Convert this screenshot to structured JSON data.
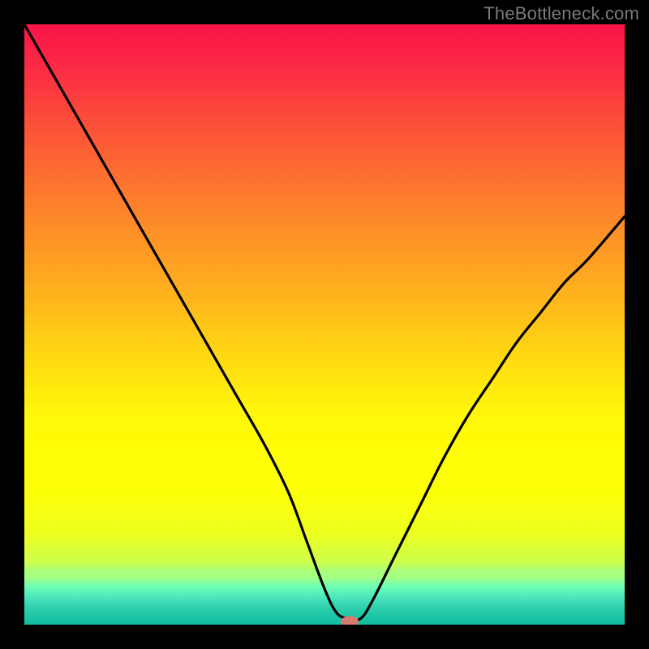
{
  "watermark": "TheBottleneck.com",
  "chart_data": {
    "type": "line",
    "title": "",
    "xlabel": "",
    "ylabel": "",
    "xlim": [
      0,
      100
    ],
    "ylim": [
      0,
      100
    ],
    "grid": false,
    "legend": false,
    "background": "rainbow_gradient_red_to_green",
    "series": [
      {
        "name": "bottleneck-curve",
        "x": [
          0,
          4,
          8,
          12,
          16,
          20,
          24,
          28,
          32,
          36,
          40,
          44,
          47,
          50,
          52,
          54,
          56,
          58,
          62,
          66,
          70,
          74,
          78,
          82,
          86,
          90,
          94,
          100
        ],
        "y": [
          100,
          93,
          86,
          79,
          72,
          65,
          58,
          51,
          44,
          37,
          30,
          22,
          14,
          6,
          2,
          1,
          1,
          4,
          12,
          20,
          28,
          35,
          41,
          47,
          52,
          57,
          61,
          68
        ],
        "description": "V-shaped curve descending steeply from top-left, reaching ~0 around x=54, rising again toward right"
      }
    ],
    "marker": {
      "name": "optimal-point",
      "shape": "rounded-oval",
      "color": "#d47b6e",
      "x": 54.2,
      "y": 0.5
    },
    "colors": {
      "top": "#fb1449",
      "mid_upper": "#fd8a28",
      "mid": "#ffe80e",
      "mid_lower": "#ccff4b",
      "bottom": "#10bea0",
      "curve": "#000000",
      "frame": "#000000"
    }
  }
}
